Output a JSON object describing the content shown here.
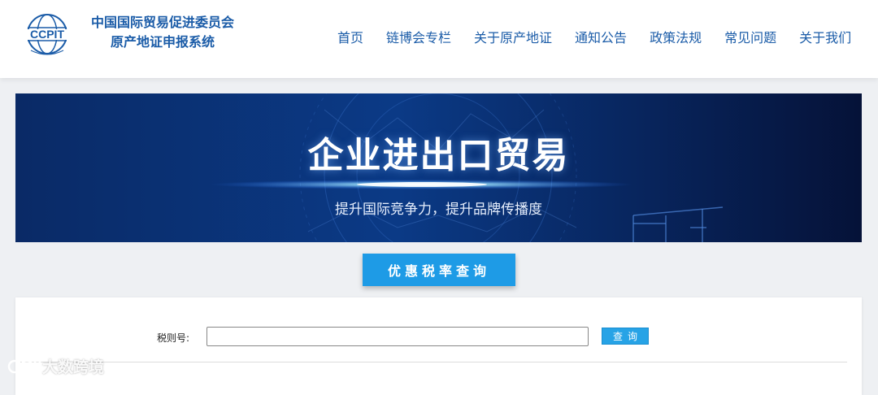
{
  "header": {
    "logo_text": "CCPIT",
    "title_line1": "中国国际贸易促进委员会",
    "title_line2": "原产地证申报系统",
    "nav": [
      "首页",
      "链博会专栏",
      "关于原产地证",
      "通知公告",
      "政策法规",
      "常见问题",
      "关于我们"
    ]
  },
  "banner": {
    "title": "企业进出口贸易",
    "subtitle": "提升国际竞争力，提升品牌传播度"
  },
  "query": {
    "button_label": "优惠税率查询",
    "field_label": "税则号:",
    "input_value": "",
    "input_placeholder": "",
    "search_label": "查询"
  },
  "watermark": {
    "text": "大数跨境"
  },
  "colors": {
    "brand_blue": "#1b5ca8",
    "button_blue": "#1e9be6",
    "banner_dark": "#061a4a"
  }
}
